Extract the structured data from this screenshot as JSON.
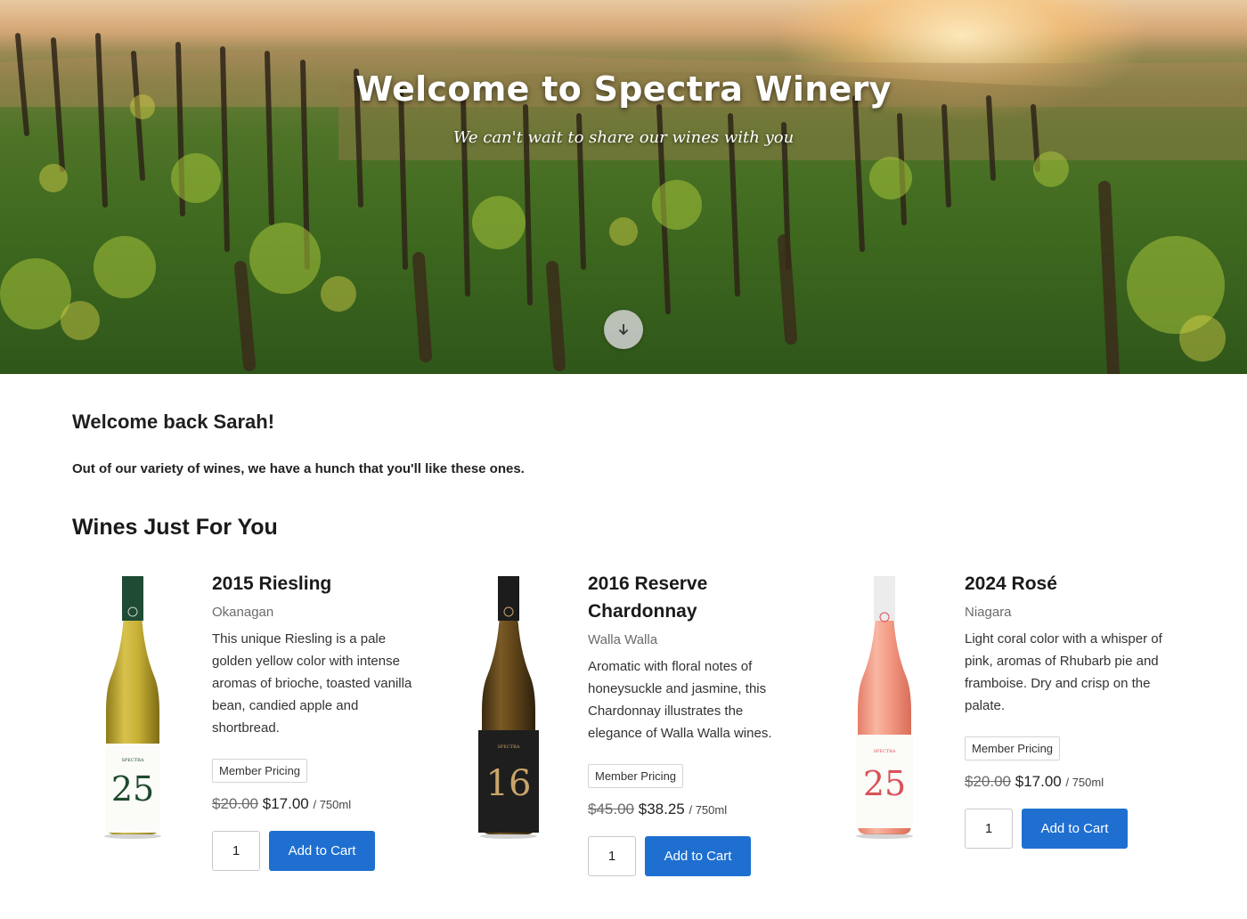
{
  "hero": {
    "title": "Welcome to Spectra Winery",
    "subtitle": "We can't wait to share our wines with you",
    "scroll_icon": "arrow-down-icon"
  },
  "greeting": "Welcome back Sarah!",
  "intro": "Out of our variety of wines, we have a hunch that you'll like these ones.",
  "section_title": "Wines Just For You",
  "colors": {
    "accent_button": "#1e6fd0",
    "riesling_label_number": "#1f4a2e",
    "chardonnay_label_number": "#c9a56a",
    "rose_label_number": "#d9525a"
  },
  "wines": [
    {
      "name": "2015 Riesling",
      "region": "Okanagan",
      "description": "This unique Riesling is a pale golden yellow color with intense aromas of brioche, toasted vanilla bean, candied apple and shortbread.",
      "badge": "Member Pricing",
      "old_price": "$20.00",
      "price": "$17.00",
      "unit": "/ 750ml",
      "qty": "1",
      "button": "Add to Cart",
      "label_number": "25",
      "label_brand": "SPECTRA"
    },
    {
      "name": "2016 Reserve Chardonnay",
      "region": "Walla Walla",
      "description": "Aromatic with floral notes of honeysuckle and jasmine, this Chardonnay illustrates the elegance of Walla Walla wines.",
      "badge": "Member Pricing",
      "old_price": "$45.00",
      "price": "$38.25",
      "unit": "/ 750ml",
      "qty": "1",
      "button": "Add to Cart",
      "label_number": "16",
      "label_brand": "SPECTRA"
    },
    {
      "name": "2024 Rosé",
      "region": "Niagara",
      "description": "Light coral color with a whisper of pink, aromas of Rhubarb pie and framboise. Dry and crisp on the palate.",
      "badge": "Member Pricing",
      "old_price": "$20.00",
      "price": "$17.00",
      "unit": "/ 750ml",
      "qty": "1",
      "button": "Add to Cart",
      "label_number": "25",
      "label_brand": "SPECTRA"
    }
  ]
}
